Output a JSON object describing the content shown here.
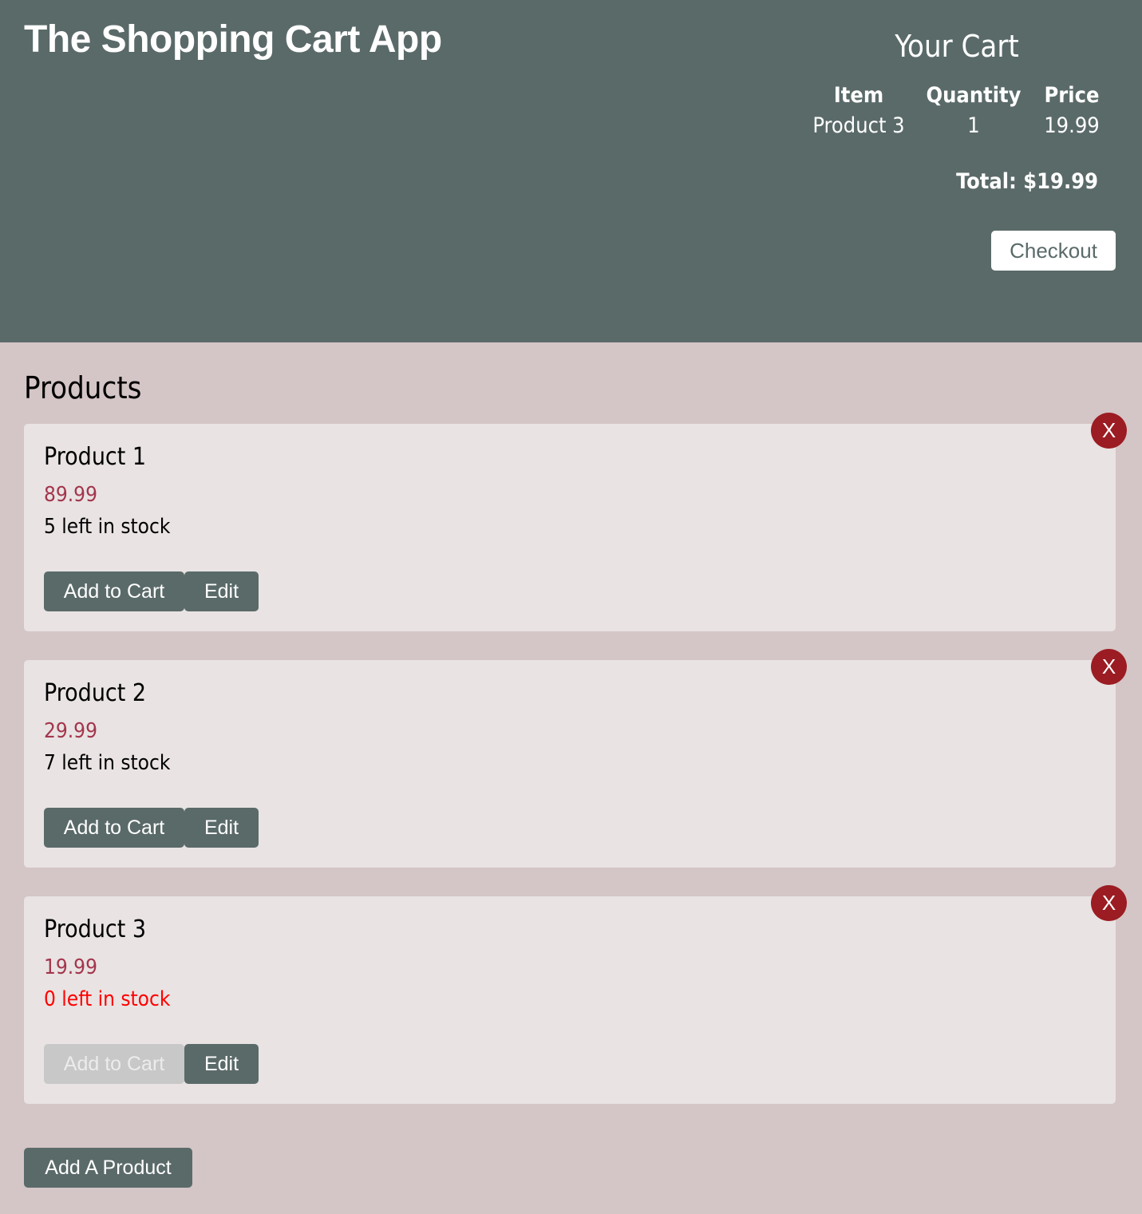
{
  "header": {
    "app_title": "The Shopping Cart App"
  },
  "cart": {
    "title": "Your Cart",
    "columns": {
      "item": "Item",
      "quantity": "Quantity",
      "price": "Price"
    },
    "rows": [
      {
        "item": "Product 3",
        "quantity": "1",
        "price": "19.99"
      }
    ],
    "total": "Total: $19.99",
    "checkout_label": "Checkout"
  },
  "products": {
    "heading": "Products",
    "items": [
      {
        "name": "Product 1",
        "price": "89.99",
        "stock": "5 left in stock",
        "add_label": "Add to Cart",
        "edit_label": "Edit",
        "delete_label": "X"
      },
      {
        "name": "Product 2",
        "price": "29.99",
        "stock": "7 left in stock",
        "add_label": "Add to Cart",
        "edit_label": "Edit",
        "delete_label": "X"
      },
      {
        "name": "Product 3",
        "price": "19.99",
        "stock": "0 left in stock",
        "add_label": "Add to Cart",
        "edit_label": "Edit",
        "delete_label": "X"
      }
    ],
    "add_product_label": "Add A Product"
  },
  "colors": {
    "header_bg": "#5a6a69",
    "page_bg": "#d4c5c6",
    "card_bg": "#e9e3e3",
    "price_text": "#a3364c",
    "out_of_stock_text": "#ff0000",
    "delete_button": "#9b1c22",
    "disabled_button": "#c8c8c8"
  }
}
